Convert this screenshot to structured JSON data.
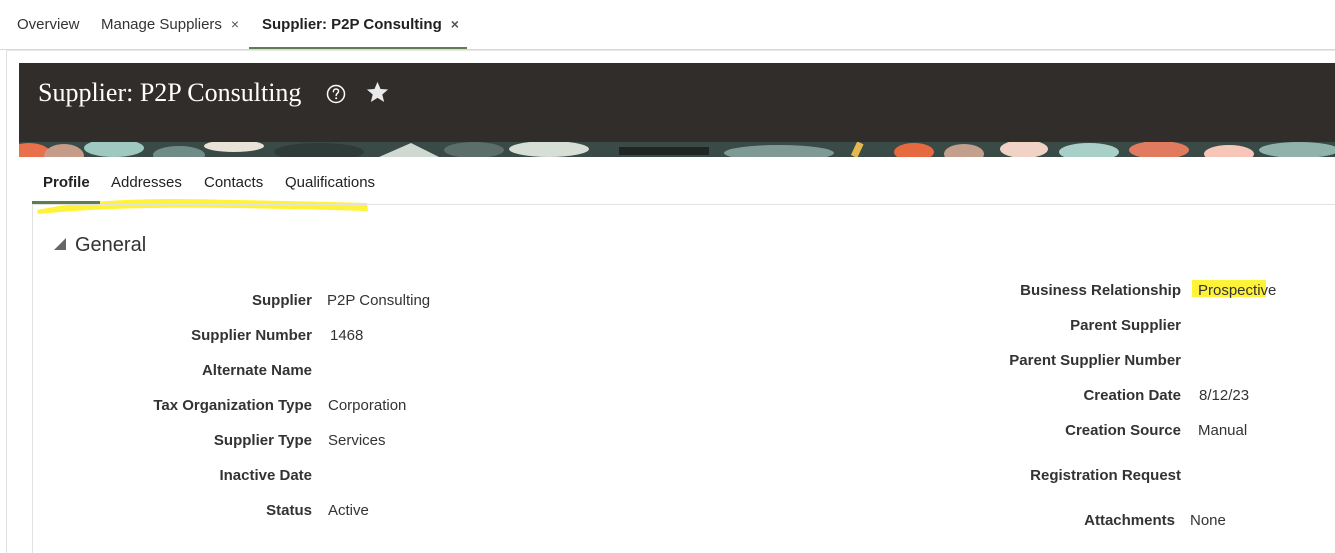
{
  "tabs": [
    {
      "label": "Overview"
    },
    {
      "label": "Manage Suppliers",
      "close": "×"
    },
    {
      "label": "Supplier: P2P Consulting",
      "close": "×"
    }
  ],
  "header": {
    "title": "Supplier: P2P Consulting",
    "help_icon": "help-circle-icon",
    "favorite_icon": "star-icon",
    "colors": {
      "banner": "#312d2a",
      "accent": "#5f7d4f",
      "highlight": "#fff33a"
    }
  },
  "subtabs": [
    {
      "label": "Profile"
    },
    {
      "label": "Addresses"
    },
    {
      "label": "Contacts"
    },
    {
      "label": "Qualifications"
    }
  ],
  "section": {
    "title": "General"
  },
  "left_fields": [
    {
      "label": "Supplier",
      "value": "P2P Consulting"
    },
    {
      "label": "Supplier Number",
      "value": "1468"
    },
    {
      "label": "Alternate Name",
      "value": ""
    },
    {
      "label": "Tax Organization Type",
      "value": "Corporation"
    },
    {
      "label": "Supplier Type",
      "value": "Services"
    },
    {
      "label": "Inactive Date",
      "value": ""
    },
    {
      "label": "Status",
      "value": "Active"
    }
  ],
  "right_fields": [
    {
      "label": "Business Relationship",
      "value": "Prospective"
    },
    {
      "label": "Parent Supplier",
      "value": ""
    },
    {
      "label": "Parent Supplier Number",
      "value": ""
    },
    {
      "label": "Creation Date",
      "value": "8/12/23"
    },
    {
      "label": "Creation Source",
      "value": "Manual"
    },
    {
      "label": "Registration Request",
      "value": ""
    },
    {
      "label": "Attachments",
      "value": "None"
    }
  ]
}
